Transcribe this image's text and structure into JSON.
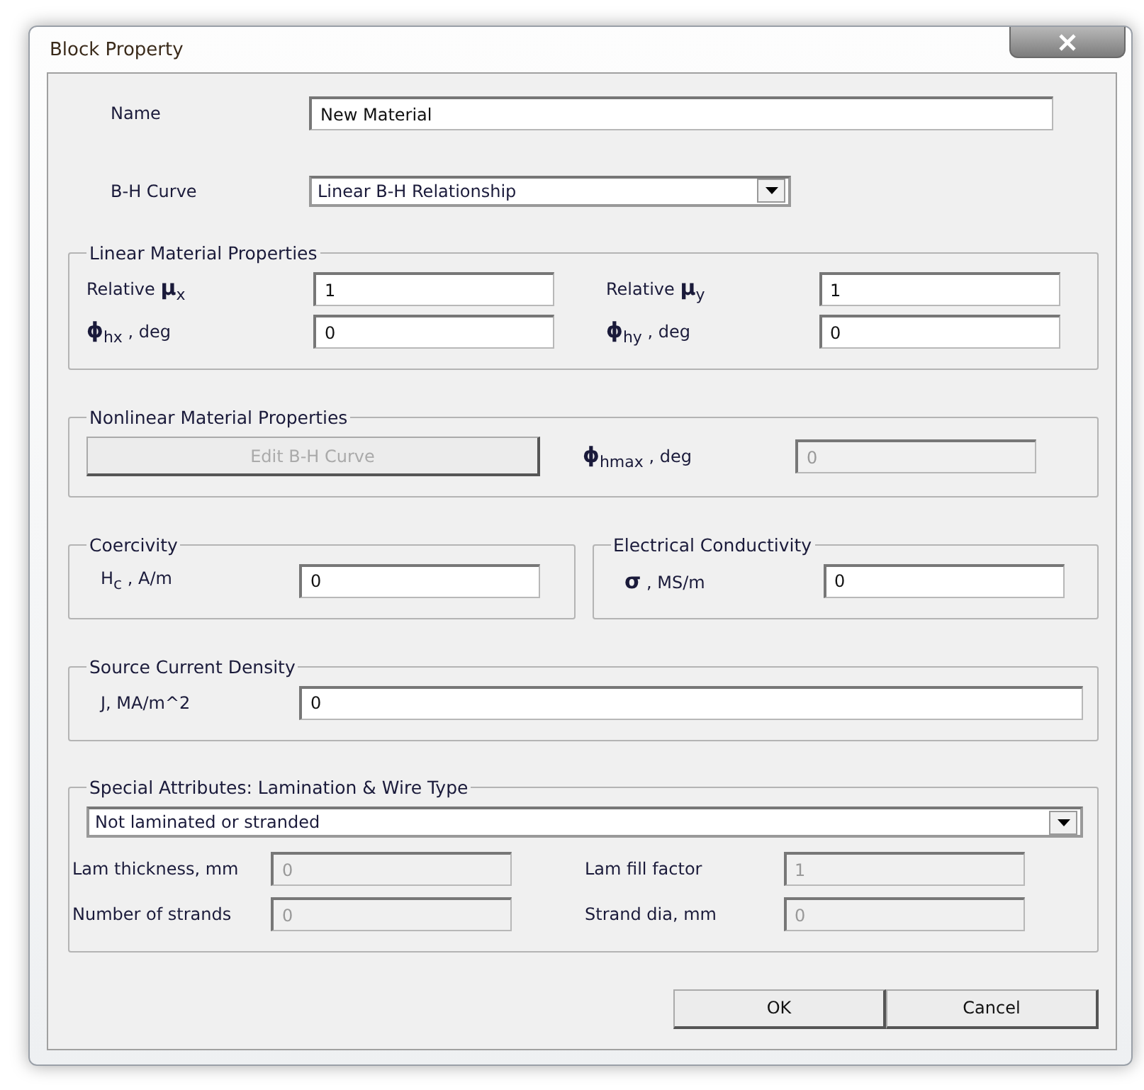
{
  "window": {
    "title": "Block Property"
  },
  "name": {
    "label": "Name",
    "value": "New Material",
    "disabled": false
  },
  "bh_curve": {
    "label": "B-H Curve",
    "value": "Linear B-H Relationship"
  },
  "linear": {
    "title": "Linear Material Properties",
    "fields": [
      {
        "label": "Relative  **μ**$_{x}$",
        "value": "1",
        "disabled": false
      },
      {
        "label": "Relative  **μ**$_{y}$",
        "value": "1",
        "disabled": false
      },
      {
        "label": "**ϕ**$_{hx}$ , deg",
        "value": "0",
        "disabled": false
      },
      {
        "label": "**ϕ**$_{hy}$ , deg",
        "value": "0",
        "disabled": false
      }
    ]
  },
  "nonlinear": {
    "title": "Nonlinear Material Properties",
    "button": {
      "label": "Edit B-H Curve",
      "disabled": true
    },
    "field": {
      "label": "**ϕ**$_{hmax}$ , deg",
      "value": "0",
      "disabled": true
    }
  },
  "coercivity": {
    "title": "Coercivity",
    "field": {
      "label": "H$_{c}$ , A/m",
      "value": "0",
      "disabled": false
    }
  },
  "conductivity": {
    "title": "Electrical Conductivity",
    "field": {
      "label": "**σ** , MS/m",
      "value": "0",
      "disabled": false
    }
  },
  "source": {
    "title": "Source Current Density",
    "field": {
      "label": "J, MA/m^2",
      "value": "0",
      "disabled": false
    }
  },
  "special": {
    "title": "Special Attributes:  Lamination & Wire Type",
    "select": "Not laminated or stranded",
    "fields": [
      {
        "label": "Lam thickness, mm",
        "value": "0",
        "disabled": true
      },
      {
        "label": "Lam fill factor",
        "value": "1",
        "disabled": true
      },
      {
        "label": "Number of strands",
        "value": "0",
        "disabled": true
      },
      {
        "label": "Strand dia, mm",
        "value": "0",
        "disabled": true
      }
    ]
  },
  "buttons": [
    {
      "label": "OK"
    },
    {
      "label": "Cancel"
    }
  ]
}
